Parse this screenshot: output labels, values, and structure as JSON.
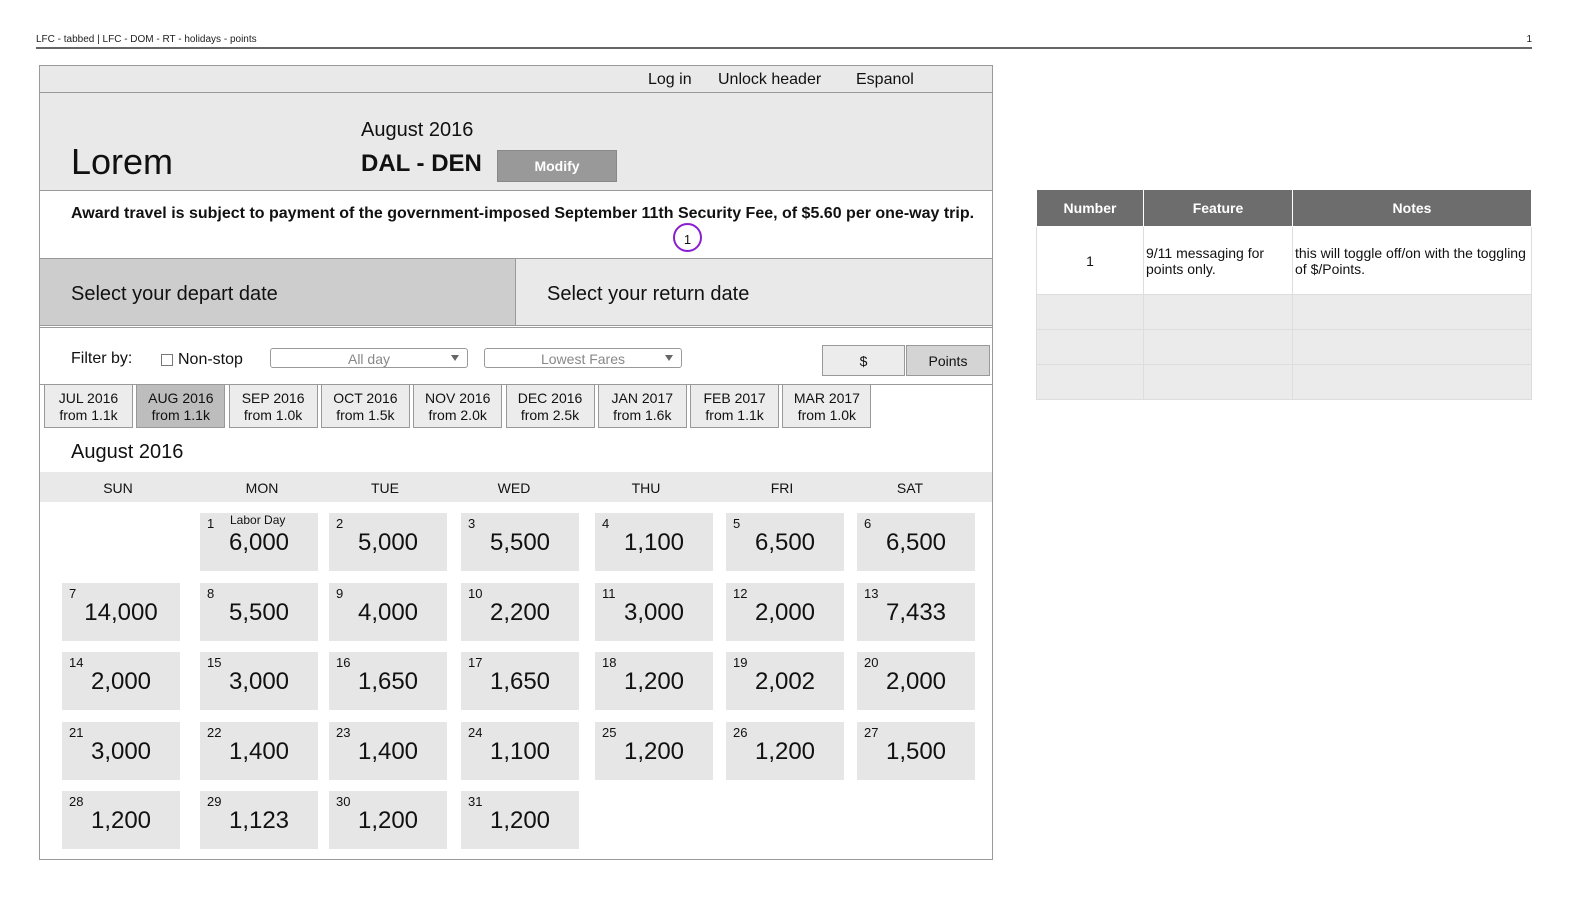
{
  "doc": {
    "title": "LFC - tabbed | LFC - DOM - RT - holidays - points",
    "page": "1"
  },
  "topbar": {
    "login": "Log in",
    "unlock": "Unlock header",
    "language": "Espanol"
  },
  "hero": {
    "logo": "Lorem",
    "month": "August 2016",
    "route": "DAL - DEN",
    "modify": "Modify"
  },
  "notice": {
    "text": "Award travel is subject to payment of the government-imposed September 11th Security Fee, of $5.60 per one-way trip.",
    "marker": "1"
  },
  "date_tabs": {
    "depart": "Select your depart date",
    "return": "Select your return date"
  },
  "filters": {
    "label": "Filter by:",
    "nonstop": "Non-stop",
    "time": "All day",
    "sort": "Lowest Fares",
    "dollar": "$",
    "points": "Points"
  },
  "months": [
    {
      "name": "JUL 2016",
      "from": "from 1.1k"
    },
    {
      "name": "AUG 2016",
      "from": "from 1.1k"
    },
    {
      "name": "SEP 2016",
      "from": "from 1.0k"
    },
    {
      "name": "OCT 2016",
      "from": "from 1.5k"
    },
    {
      "name": "NOV 2016",
      "from": "from 2.0k"
    },
    {
      "name": "DEC 2016",
      "from": "from 2.5k"
    },
    {
      "name": "JAN 2017",
      "from": "from 1.6k"
    },
    {
      "name": "FEB 2017",
      "from": "from 1.1k"
    },
    {
      "name": "MAR 2017",
      "from": "from 1.0k"
    }
  ],
  "calendar": {
    "title": "August 2016",
    "weekdays": [
      "SUN",
      "MON",
      "TUE",
      "WED",
      "THU",
      "FRI",
      "SAT"
    ],
    "holiday": "Labor Day",
    "days": [
      [
        "1",
        "6,000"
      ],
      [
        "2",
        "5,000"
      ],
      [
        "3",
        "5,500"
      ],
      [
        "4",
        "1,100"
      ],
      [
        "5",
        "6,500"
      ],
      [
        "6",
        "6,500"
      ],
      [
        "7",
        "14,000"
      ],
      [
        "8",
        "5,500"
      ],
      [
        "9",
        "4,000"
      ],
      [
        "10",
        "2,200"
      ],
      [
        "11",
        "3,000"
      ],
      [
        "12",
        "2,000"
      ],
      [
        "13",
        "7,433"
      ],
      [
        "14",
        "2,000"
      ],
      [
        "15",
        "3,000"
      ],
      [
        "16",
        "1,650"
      ],
      [
        "17",
        "1,650"
      ],
      [
        "18",
        "1,200"
      ],
      [
        "19",
        "2,002"
      ],
      [
        "20",
        "2,000"
      ],
      [
        "21",
        "3,000"
      ],
      [
        "22",
        "1,400"
      ],
      [
        "23",
        "1,400"
      ],
      [
        "24",
        "1,100"
      ],
      [
        "25",
        "1,200"
      ],
      [
        "26",
        "1,200"
      ],
      [
        "27",
        "1,500"
      ],
      [
        "28",
        "1,200"
      ],
      [
        "29",
        "1,123"
      ],
      [
        "30",
        "1,200"
      ],
      [
        "31",
        "1,200"
      ]
    ]
  },
  "notes_table": {
    "headers": [
      "Number",
      "Feature",
      "Notes"
    ],
    "rows": [
      {
        "number": "1",
        "feature": "9/11 messaging for points only.",
        "notes": "this will toggle off/on with the toggling of $/Points."
      }
    ]
  }
}
